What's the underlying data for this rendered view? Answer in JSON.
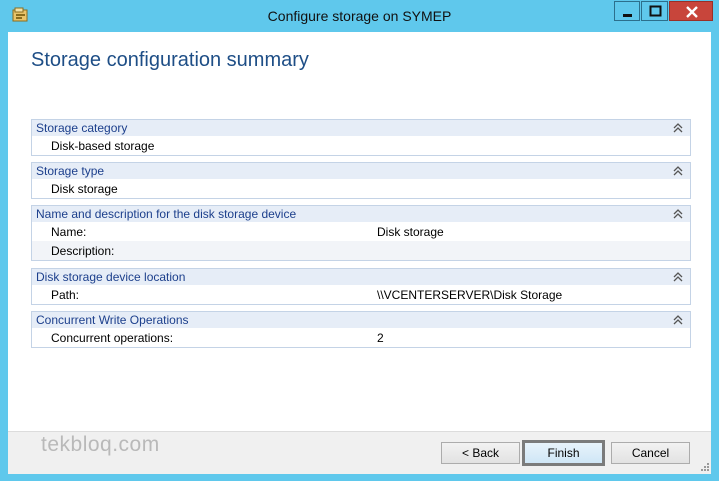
{
  "window": {
    "title": "Configure storage on SYMEP",
    "accent": "#5fc8ec",
    "close_color": "#c8453b",
    "icons": [
      "app-icon",
      "minimize-icon",
      "maximize-icon",
      "close-icon"
    ]
  },
  "page": {
    "heading": "Storage configuration summary"
  },
  "sections": [
    {
      "title": "Storage category",
      "rows": [
        {
          "key": "Disk-based storage",
          "value": ""
        }
      ]
    },
    {
      "title": "Storage type",
      "rows": [
        {
          "key": "Disk storage",
          "value": ""
        }
      ]
    },
    {
      "title": "Name and description for the disk storage device",
      "rows": [
        {
          "key": "Name:",
          "value": "Disk storage"
        },
        {
          "key": "Description:",
          "value": ""
        }
      ]
    },
    {
      "title": "Disk storage device location",
      "rows": [
        {
          "key": "Path:",
          "value": "\\\\VCENTERSERVER\\Disk Storage"
        }
      ]
    },
    {
      "title": "Concurrent Write Operations",
      "rows": [
        {
          "key": "Concurrent operations:",
          "value": "2"
        }
      ]
    }
  ],
  "footer": {
    "watermark": "tekbloq.com",
    "back_label": "< Back",
    "finish_label": "Finish",
    "cancel_label": "Cancel"
  }
}
